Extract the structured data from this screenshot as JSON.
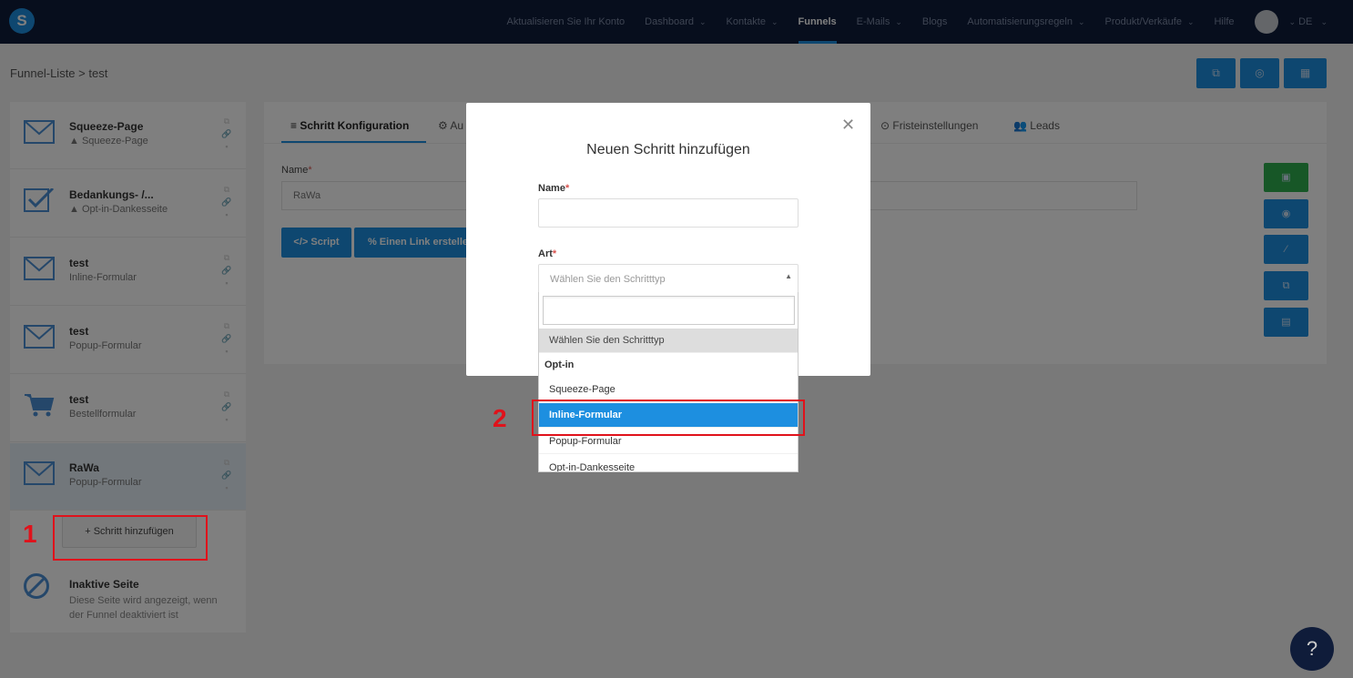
{
  "nav": {
    "logo": "S",
    "items": [
      {
        "label": "Aktualisieren Sie Ihr Konto",
        "caret": false,
        "active": false
      },
      {
        "label": "Dashboard",
        "caret": true,
        "active": false
      },
      {
        "label": "Kontakte",
        "caret": true,
        "active": false
      },
      {
        "label": "Funnels",
        "caret": false,
        "active": true
      },
      {
        "label": "E-Mails",
        "caret": true,
        "active": false
      },
      {
        "label": "Blogs",
        "caret": false,
        "active": false
      },
      {
        "label": "Automatisierungsregeln",
        "caret": true,
        "active": false
      },
      {
        "label": "Produkt/Verkäufe",
        "caret": true,
        "active": false
      },
      {
        "label": "Hilfe",
        "caret": false,
        "active": false
      }
    ],
    "language": "DE"
  },
  "breadcrumb": "Funnel-Liste > test",
  "header_buttons": [
    "external-link-icon",
    "gear-icon",
    "store-icon"
  ],
  "sidebar": {
    "steps": [
      {
        "title": "Squeeze-Page",
        "subtitle": "▲ Squeeze-Page",
        "icon": "envelope-icon"
      },
      {
        "title": "Bedankungs- /...",
        "subtitle": "▲ Opt-in-Dankesseite",
        "icon": "checkbox-icon"
      },
      {
        "title": "test",
        "subtitle": "Inline-Formular",
        "icon": "envelope-icon"
      },
      {
        "title": "test",
        "subtitle": "Popup-Formular",
        "icon": "envelope-icon"
      },
      {
        "title": "test",
        "subtitle": "Bestellformular",
        "icon": "cart-icon"
      },
      {
        "title": "RaWa",
        "subtitle": "Popup-Formular",
        "icon": "envelope-icon"
      }
    ],
    "add_step": "+ Schritt hinzufügen",
    "inactive_title": "Inaktive Seite",
    "inactive_desc": "Diese Seite wird angezeigt, wenn der Funnel deaktiviert ist"
  },
  "main": {
    "tabs": {
      "config": "≡ Schritt Konfiguration",
      "auto": "⚙ Au",
      "deadlines": "⊙ Fristeinstellungen",
      "leads": "👥 Leads"
    },
    "name_label": "Name",
    "name_value": "RaWa",
    "script_button": "</> Script",
    "link_button": "% Einen Link erstelle"
  },
  "modal": {
    "title": "Neuen Schritt hinzufügen",
    "name_label": "Name",
    "type_label": "Art",
    "select_placeholder": "Wählen Sie den Schritttyp",
    "options": {
      "placeholder": "Wählen Sie den Schritttyp",
      "group": "Opt-in",
      "squeeze": "Squeeze-Page",
      "inline": "Inline-Formular",
      "popup": "Popup-Formular",
      "thanks": "Opt-in-Dankesseite"
    }
  },
  "annotations": {
    "one": "1",
    "two": "2"
  },
  "help": "?",
  "colors": {
    "accent": "#1d8fe0",
    "nav": "#0f1c3a",
    "annotation": "#e0121b",
    "save": "#2eae4f"
  }
}
